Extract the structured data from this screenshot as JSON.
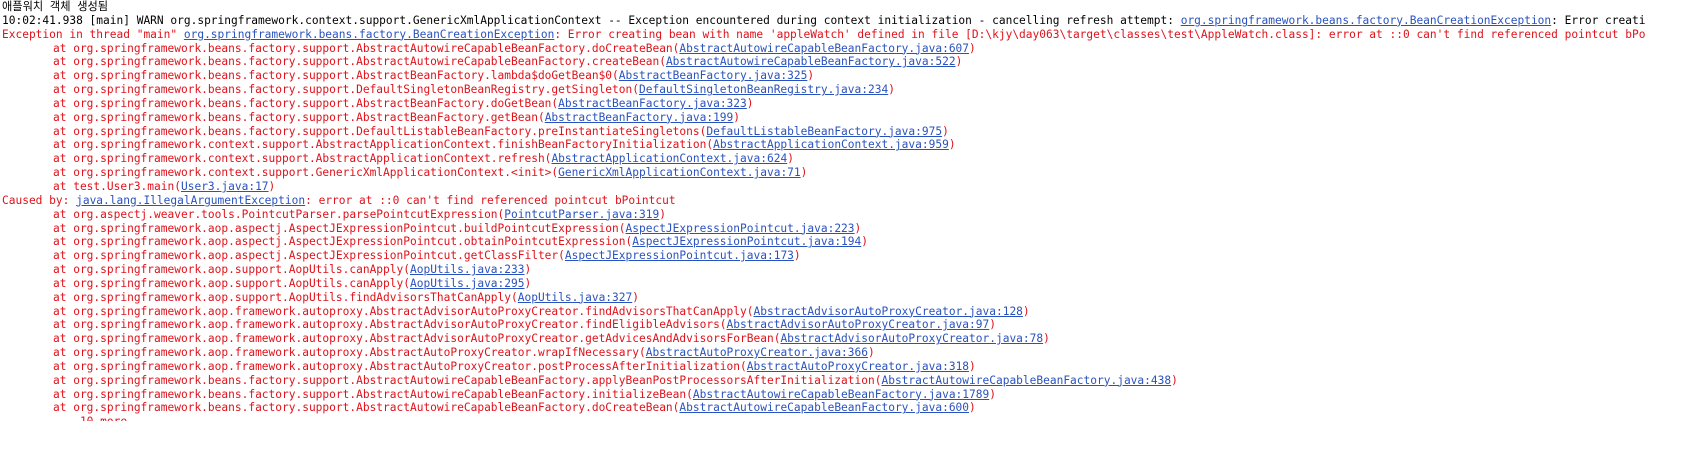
{
  "colors": {
    "stdout": "#000000",
    "stderr": "#e0121b",
    "link": "#2a52be",
    "background": "#ffffff"
  },
  "lines": [
    {
      "s": "out",
      "indent": false,
      "segs": [
        {
          "t": "애플워치 객체 생성됨"
        }
      ]
    },
    {
      "s": "out",
      "indent": false,
      "segs": [
        {
          "t": "10:02:41.938 [main] WARN org.springframework.context.support.GenericXmlApplicationContext -- Exception encountered during context initialization - cancelling refresh attempt: "
        },
        {
          "t": "org.springframework.beans.factory.BeanCreationException",
          "link": true
        },
        {
          "t": ": Error creati"
        }
      ]
    },
    {
      "s": "err",
      "indent": false,
      "segs": [
        {
          "t": "Exception in thread \"main\" "
        },
        {
          "t": "org.springframework.beans.factory.BeanCreationException",
          "link": true
        },
        {
          "t": ": Error creating bean with name 'appleWatch' defined in file [D:\\kjy\\day063\\target\\classes\\test\\AppleWatch.class]: error at ::0 can't find referenced pointcut bPo"
        }
      ]
    },
    {
      "s": "err",
      "indent": true,
      "segs": [
        {
          "t": "at org.springframework.beans.factory.support.AbstractAutowireCapableBeanFactory.doCreateBean("
        },
        {
          "t": "AbstractAutowireCapableBeanFactory.java:607",
          "link": true
        },
        {
          "t": ")"
        }
      ]
    },
    {
      "s": "err",
      "indent": true,
      "segs": [
        {
          "t": "at org.springframework.beans.factory.support.AbstractAutowireCapableBeanFactory.createBean("
        },
        {
          "t": "AbstractAutowireCapableBeanFactory.java:522",
          "link": true
        },
        {
          "t": ")"
        }
      ]
    },
    {
      "s": "err",
      "indent": true,
      "segs": [
        {
          "t": "at org.springframework.beans.factory.support.AbstractBeanFactory.lambda$doGetBean$0("
        },
        {
          "t": "AbstractBeanFactory.java:325",
          "link": true
        },
        {
          "t": ")"
        }
      ]
    },
    {
      "s": "err",
      "indent": true,
      "segs": [
        {
          "t": "at org.springframework.beans.factory.support.DefaultSingletonBeanRegistry.getSingleton("
        },
        {
          "t": "DefaultSingletonBeanRegistry.java:234",
          "link": true
        },
        {
          "t": ")"
        }
      ]
    },
    {
      "s": "err",
      "indent": true,
      "segs": [
        {
          "t": "at org.springframework.beans.factory.support.AbstractBeanFactory.doGetBean("
        },
        {
          "t": "AbstractBeanFactory.java:323",
          "link": true
        },
        {
          "t": ")"
        }
      ]
    },
    {
      "s": "err",
      "indent": true,
      "segs": [
        {
          "t": "at org.springframework.beans.factory.support.AbstractBeanFactory.getBean("
        },
        {
          "t": "AbstractBeanFactory.java:199",
          "link": true
        },
        {
          "t": ")"
        }
      ]
    },
    {
      "s": "err",
      "indent": true,
      "segs": [
        {
          "t": "at org.springframework.beans.factory.support.DefaultListableBeanFactory.preInstantiateSingletons("
        },
        {
          "t": "DefaultListableBeanFactory.java:975",
          "link": true
        },
        {
          "t": ")"
        }
      ]
    },
    {
      "s": "err",
      "indent": true,
      "segs": [
        {
          "t": "at org.springframework.context.support.AbstractApplicationContext.finishBeanFactoryInitialization("
        },
        {
          "t": "AbstractApplicationContext.java:959",
          "link": true
        },
        {
          "t": ")"
        }
      ]
    },
    {
      "s": "err",
      "indent": true,
      "segs": [
        {
          "t": "at org.springframework.context.support.AbstractApplicationContext.refresh("
        },
        {
          "t": "AbstractApplicationContext.java:624",
          "link": true
        },
        {
          "t": ")"
        }
      ]
    },
    {
      "s": "err",
      "indent": true,
      "segs": [
        {
          "t": "at org.springframework.context.support.GenericXmlApplicationContext.<init>("
        },
        {
          "t": "GenericXmlApplicationContext.java:71",
          "link": true
        },
        {
          "t": ")"
        }
      ]
    },
    {
      "s": "err",
      "indent": true,
      "segs": [
        {
          "t": "at test.User3.main("
        },
        {
          "t": "User3.java:17",
          "link": true
        },
        {
          "t": ")"
        }
      ]
    },
    {
      "s": "err",
      "indent": false,
      "segs": [
        {
          "t": "Caused by: "
        },
        {
          "t": "java.lang.IllegalArgumentException",
          "link": true
        },
        {
          "t": ": error at ::0 can't find referenced pointcut bPointcut"
        }
      ]
    },
    {
      "s": "err",
      "indent": true,
      "segs": [
        {
          "t": "at org.aspectj.weaver.tools.PointcutParser.parsePointcutExpression("
        },
        {
          "t": "PointcutParser.java:319",
          "link": true
        },
        {
          "t": ")"
        }
      ]
    },
    {
      "s": "err",
      "indent": true,
      "segs": [
        {
          "t": "at org.springframework.aop.aspectj.AspectJExpressionPointcut.buildPointcutExpression("
        },
        {
          "t": "AspectJExpressionPointcut.java:223",
          "link": true
        },
        {
          "t": ")"
        }
      ]
    },
    {
      "s": "err",
      "indent": true,
      "segs": [
        {
          "t": "at org.springframework.aop.aspectj.AspectJExpressionPointcut.obtainPointcutExpression("
        },
        {
          "t": "AspectJExpressionPointcut.java:194",
          "link": true
        },
        {
          "t": ")"
        }
      ]
    },
    {
      "s": "err",
      "indent": true,
      "segs": [
        {
          "t": "at org.springframework.aop.aspectj.AspectJExpressionPointcut.getClassFilter("
        },
        {
          "t": "AspectJExpressionPointcut.java:173",
          "link": true
        },
        {
          "t": ")"
        }
      ]
    },
    {
      "s": "err",
      "indent": true,
      "segs": [
        {
          "t": "at org.springframework.aop.support.AopUtils.canApply("
        },
        {
          "t": "AopUtils.java:233",
          "link": true
        },
        {
          "t": ")"
        }
      ]
    },
    {
      "s": "err",
      "indent": true,
      "segs": [
        {
          "t": "at org.springframework.aop.support.AopUtils.canApply("
        },
        {
          "t": "AopUtils.java:295",
          "link": true
        },
        {
          "t": ")"
        }
      ]
    },
    {
      "s": "err",
      "indent": true,
      "segs": [
        {
          "t": "at org.springframework.aop.support.AopUtils.findAdvisorsThatCanApply("
        },
        {
          "t": "AopUtils.java:327",
          "link": true
        },
        {
          "t": ")"
        }
      ]
    },
    {
      "s": "err",
      "indent": true,
      "segs": [
        {
          "t": "at org.springframework.aop.framework.autoproxy.AbstractAdvisorAutoProxyCreator.findAdvisorsThatCanApply("
        },
        {
          "t": "AbstractAdvisorAutoProxyCreator.java:128",
          "link": true
        },
        {
          "t": ")"
        }
      ]
    },
    {
      "s": "err",
      "indent": true,
      "segs": [
        {
          "t": "at org.springframework.aop.framework.autoproxy.AbstractAdvisorAutoProxyCreator.findEligibleAdvisors("
        },
        {
          "t": "AbstractAdvisorAutoProxyCreator.java:97",
          "link": true
        },
        {
          "t": ")"
        }
      ]
    },
    {
      "s": "err",
      "indent": true,
      "segs": [
        {
          "t": "at org.springframework.aop.framework.autoproxy.AbstractAdvisorAutoProxyCreator.getAdvicesAndAdvisorsForBean("
        },
        {
          "t": "AbstractAdvisorAutoProxyCreator.java:78",
          "link": true
        },
        {
          "t": ")"
        }
      ]
    },
    {
      "s": "err",
      "indent": true,
      "segs": [
        {
          "t": "at org.springframework.aop.framework.autoproxy.AbstractAutoProxyCreator.wrapIfNecessary("
        },
        {
          "t": "AbstractAutoProxyCreator.java:366",
          "link": true
        },
        {
          "t": ")"
        }
      ]
    },
    {
      "s": "err",
      "indent": true,
      "segs": [
        {
          "t": "at org.springframework.aop.framework.autoproxy.AbstractAutoProxyCreator.postProcessAfterInitialization("
        },
        {
          "t": "AbstractAutoProxyCreator.java:318",
          "link": true
        },
        {
          "t": ")"
        }
      ]
    },
    {
      "s": "err",
      "indent": true,
      "segs": [
        {
          "t": "at org.springframework.beans.factory.support.AbstractAutowireCapableBeanFactory.applyBeanPostProcessorsAfterInitialization("
        },
        {
          "t": "AbstractAutowireCapableBeanFactory.java:438",
          "link": true
        },
        {
          "t": ")"
        }
      ]
    },
    {
      "s": "err",
      "indent": true,
      "segs": [
        {
          "t": "at org.springframework.beans.factory.support.AbstractAutowireCapableBeanFactory.initializeBean("
        },
        {
          "t": "AbstractAutowireCapableBeanFactory.java:1789",
          "link": true
        },
        {
          "t": ")"
        }
      ]
    },
    {
      "s": "err",
      "indent": true,
      "segs": [
        {
          "t": "at org.springframework.beans.factory.support.AbstractAutowireCapableBeanFactory.doCreateBean("
        },
        {
          "t": "AbstractAutowireCapableBeanFactory.java:600",
          "link": true
        },
        {
          "t": ")"
        }
      ]
    },
    {
      "s": "err",
      "indent": true,
      "cut": true,
      "segs": [
        {
          "t": "... 10 more"
        }
      ]
    }
  ]
}
